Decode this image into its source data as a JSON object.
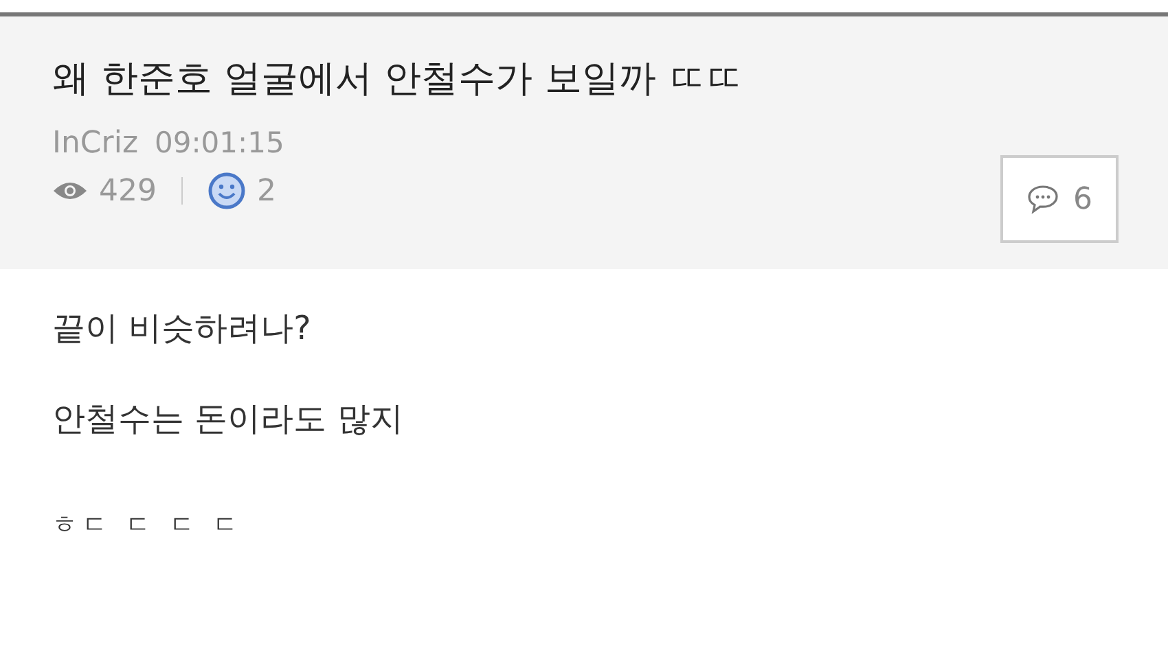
{
  "post": {
    "title": "왜 한준호 얼굴에서 안철수가 보일까 ㄸㄸ",
    "author": "InCriz",
    "time": "09:01:15",
    "views": "429",
    "likes": "2",
    "comments": "6"
  },
  "body": [
    "끝이 비슷하려나?",
    "안철수는 돈이라도 많지",
    "ㅎㄷ ㄷ ㄷ ㄷ"
  ]
}
